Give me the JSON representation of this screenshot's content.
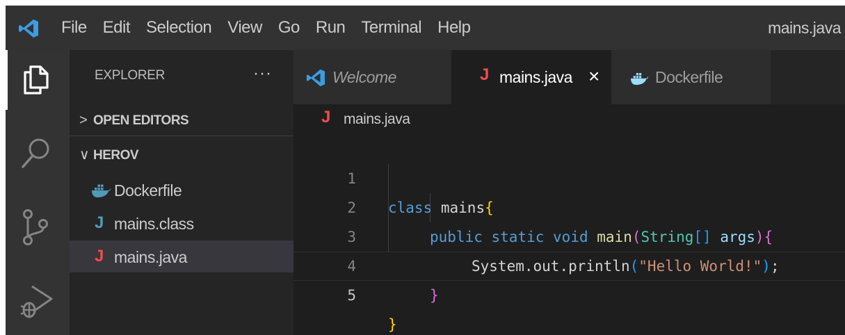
{
  "titlebar": {
    "logo_icon": "vscode-logo-icon",
    "menu": [
      "File",
      "Edit",
      "Selection",
      "View",
      "Go",
      "Run",
      "Terminal",
      "Help"
    ],
    "window_title": "mains.java"
  },
  "activity_bar": {
    "items": [
      {
        "icon": "explorer-icon",
        "active": true
      },
      {
        "icon": "search-icon",
        "active": false
      },
      {
        "icon": "source-control-icon",
        "active": false
      },
      {
        "icon": "run-debug-icon",
        "active": false
      }
    ]
  },
  "sidebar": {
    "title": "EXPLORER",
    "more": "···",
    "open_editors": {
      "chevron": ">",
      "label": "OPEN EDITORS"
    },
    "folder": {
      "chevron": "∨",
      "label": "HEROV"
    },
    "files": [
      {
        "name": "Dockerfile",
        "icon": "docker-icon",
        "selected": false
      },
      {
        "name": "mains.class",
        "icon": "java-class-icon",
        "selected": false
      },
      {
        "name": "mains.java",
        "icon": "java-file-icon",
        "selected": true
      }
    ]
  },
  "tabs": [
    {
      "label": "Welcome",
      "icon": "vscode-logo-icon",
      "active": false,
      "italic": true
    },
    {
      "label": "mains.java",
      "icon": "java-file-icon",
      "active": true,
      "close": "×"
    },
    {
      "label": "Dockerfile",
      "icon": "docker-icon",
      "active": false
    }
  ],
  "breadcrumb": {
    "icon": "java-file-icon",
    "label": "mains.java"
  },
  "editor": {
    "current_line": 5,
    "lines": [
      {
        "n": "1"
      },
      {
        "n": "2"
      },
      {
        "n": "3"
      },
      {
        "n": "4"
      },
      {
        "n": "5"
      }
    ],
    "tokens": {
      "l1": {
        "kw": "class",
        "name": "mains",
        "b": "{"
      },
      "l2": {
        "kw1": "public",
        "kw2": "static",
        "kw3": "void",
        "fn": "main",
        "p1": "(",
        "type": "String",
        "arr": "[]",
        "arg": "args",
        "p2": ")",
        "b": "{"
      },
      "l3": {
        "obj": "System",
        "d1": ".",
        "fld": "out",
        "d2": ".",
        "fn": "println",
        "p1": "(",
        "str": "\"Hello World!\"",
        "p2": ")",
        "semi": ";"
      },
      "l4": {
        "b": "}"
      },
      "l5": {
        "b": "}"
      }
    }
  },
  "colors": {
    "java_icon": "#f14c4c",
    "java_class_icon": "#519aba",
    "docker_icon": "#519aba",
    "vscode_blue": "#3b9de3"
  }
}
